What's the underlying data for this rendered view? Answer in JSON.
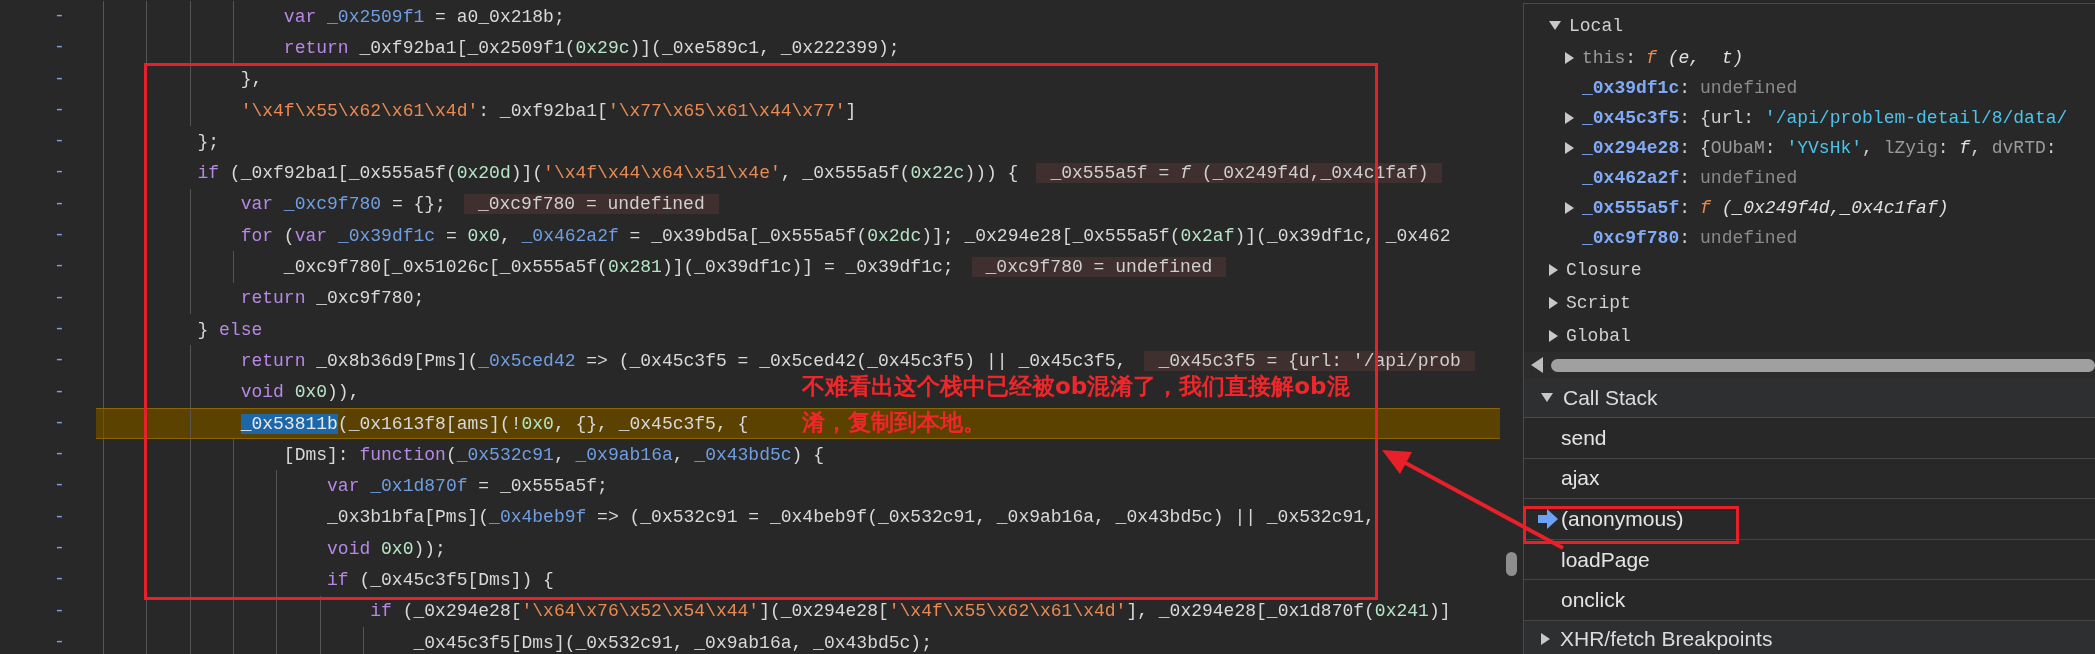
{
  "code_lines": [
    {
      "marker": "-",
      "paused": false,
      "tokens": [
        {
          "kind": "kw",
          "text": "                var "
        },
        {
          "kind": "def",
          "text": "_0x2509f1"
        },
        {
          "kind": "txt",
          "text": " = a0_0x218b;"
        }
      ]
    },
    {
      "marker": "-",
      "paused": false,
      "tokens": [
        {
          "kind": "kw",
          "text": "                return"
        },
        {
          "kind": "txt",
          "text": " _0xf92ba1[_0x2509f1("
        },
        {
          "kind": "num",
          "text": "0x29c"
        },
        {
          "kind": "txt",
          "text": ")](_0xe589c1, _0x222399);"
        }
      ]
    },
    {
      "marker": "-",
      "paused": false,
      "tokens": [
        {
          "kind": "txt",
          "text": "            },"
        }
      ]
    },
    {
      "marker": "-",
      "paused": false,
      "tokens": [
        {
          "kind": "str",
          "text": "            '\\x4f\\x55\\x62\\x61\\x4d'"
        },
        {
          "kind": "txt",
          "text": ": _0xf92ba1["
        },
        {
          "kind": "str",
          "text": "'\\x77\\x65\\x61\\x44\\x77'"
        },
        {
          "kind": "txt",
          "text": "]"
        }
      ]
    },
    {
      "marker": "-",
      "paused": false,
      "tokens": [
        {
          "kind": "txt",
          "text": "        };"
        }
      ]
    },
    {
      "marker": "-",
      "paused": false,
      "tokens": [
        {
          "kind": "kw",
          "text": "        if"
        },
        {
          "kind": "txt",
          "text": " (_0xf92ba1[_0x555a5f("
        },
        {
          "kind": "num",
          "text": "0x20d"
        },
        {
          "kind": "txt",
          "text": ")]("
        },
        {
          "kind": "str",
          "text": "'\\x4f\\x44\\x64\\x51\\x4e'"
        },
        {
          "kind": "txt",
          "text": ", _0x555a5f("
        },
        {
          "kind": "num",
          "text": "0x22c"
        },
        {
          "kind": "txt",
          "text": "))) {"
        }
      ],
      "inline_value": "_0x555a5f = *f* (_0x249f4d,_0x4c1faf)"
    },
    {
      "marker": "-",
      "paused": false,
      "tokens": [
        {
          "kind": "kw",
          "text": "            var "
        },
        {
          "kind": "def",
          "text": "_0xc9f780"
        },
        {
          "kind": "txt",
          "text": " = {};"
        }
      ],
      "inline_value": "_0xc9f780 = undefined"
    },
    {
      "marker": "-",
      "paused": false,
      "tokens": [
        {
          "kind": "kw",
          "text": "            for"
        },
        {
          "kind": "txt",
          "text": " ("
        },
        {
          "kind": "kw",
          "text": "var "
        },
        {
          "kind": "def",
          "text": "_0x39df1c"
        },
        {
          "kind": "txt",
          "text": " = "
        },
        {
          "kind": "num",
          "text": "0x0"
        },
        {
          "kind": "txt",
          "text": ", "
        },
        {
          "kind": "def",
          "text": "_0x462a2f"
        },
        {
          "kind": "txt",
          "text": " = _0x39bd5a[_0x555a5f("
        },
        {
          "kind": "num",
          "text": "0x2dc"
        },
        {
          "kind": "txt",
          "text": ")]; _0x294e28[_0x555a5f("
        },
        {
          "kind": "num",
          "text": "0x2af"
        },
        {
          "kind": "txt",
          "text": ")](_0x39df1c, _0x462"
        }
      ]
    },
    {
      "marker": "-",
      "paused": false,
      "tokens": [
        {
          "kind": "txt",
          "text": "                _0xc9f780[_0x51026c[_0x555a5f("
        },
        {
          "kind": "num",
          "text": "0x281"
        },
        {
          "kind": "txt",
          "text": ")](_0x39df1c)] = _0x39df1c;"
        }
      ],
      "inline_value": "_0xc9f780 = undefined"
    },
    {
      "marker": "-",
      "paused": false,
      "tokens": [
        {
          "kind": "kw",
          "text": "            return"
        },
        {
          "kind": "txt",
          "text": " _0xc9f780;"
        }
      ]
    },
    {
      "marker": "-",
      "paused": false,
      "tokens": [
        {
          "kind": "txt",
          "text": "        } "
        },
        {
          "kind": "kw",
          "text": "else"
        }
      ]
    },
    {
      "marker": "-",
      "paused": false,
      "tokens": [
        {
          "kind": "kw",
          "text": "            return"
        },
        {
          "kind": "txt",
          "text": " _0x8b36d9[Pms]("
        },
        {
          "kind": "def",
          "text": "_0x5ced42"
        },
        {
          "kind": "txt",
          "text": " => (_0x45c3f5 = _0x5ced42(_0x45c3f5) || _0x45c3f5,"
        }
      ],
      "inline_value": "_0x45c3f5 = {url: '/api/prob"
    },
    {
      "marker": "-",
      "paused": false,
      "tokens": [
        {
          "kind": "kw",
          "text": "            void "
        },
        {
          "kind": "num",
          "text": "0x0"
        },
        {
          "kind": "txt",
          "text": ")),"
        }
      ]
    },
    {
      "marker": "-",
      "paused": true,
      "tokens": [
        {
          "kind": "selection",
          "text": "            _0x53811b"
        },
        {
          "kind": "txt",
          "text": "(_0x1613f8[ams](!"
        },
        {
          "kind": "num",
          "text": "0x0"
        },
        {
          "kind": "txt",
          "text": ", {}, _0x45c3f5, {"
        }
      ]
    },
    {
      "marker": "-",
      "paused": false,
      "tokens": [
        {
          "kind": "txt",
          "text": "                [Dms]: "
        },
        {
          "kind": "kw",
          "text": "function"
        },
        {
          "kind": "txt",
          "text": "("
        },
        {
          "kind": "def",
          "text": "_0x532c91"
        },
        {
          "kind": "txt",
          "text": ", "
        },
        {
          "kind": "def",
          "text": "_0x9ab16a"
        },
        {
          "kind": "txt",
          "text": ", "
        },
        {
          "kind": "def",
          "text": "_0x43bd5c"
        },
        {
          "kind": "txt",
          "text": ") {"
        }
      ]
    },
    {
      "marker": "-",
      "paused": false,
      "tokens": [
        {
          "kind": "kw",
          "text": "                    var "
        },
        {
          "kind": "def",
          "text": "_0x1d870f"
        },
        {
          "kind": "txt",
          "text": " = _0x555a5f;"
        }
      ]
    },
    {
      "marker": "-",
      "paused": false,
      "tokens": [
        {
          "kind": "txt",
          "text": "                    _0x3b1bfa[Pms]("
        },
        {
          "kind": "def",
          "text": "_0x4beb9f"
        },
        {
          "kind": "txt",
          "text": " => (_0x532c91 = _0x4beb9f(_0x532c91, _0x9ab16a, _0x43bd5c) || _0x532c91,"
        }
      ]
    },
    {
      "marker": "-",
      "paused": false,
      "tokens": [
        {
          "kind": "kw",
          "text": "                    void "
        },
        {
          "kind": "num",
          "text": "0x0"
        },
        {
          "kind": "txt",
          "text": "));"
        }
      ]
    },
    {
      "marker": "-",
      "paused": false,
      "tokens": [
        {
          "kind": "kw",
          "text": "                    if"
        },
        {
          "kind": "txt",
          "text": " (_0x45c3f5[Dms]) {"
        }
      ]
    },
    {
      "marker": "-",
      "paused": false,
      "tokens": [
        {
          "kind": "kw",
          "text": "                        if"
        },
        {
          "kind": "txt",
          "text": " (_0x294e28["
        },
        {
          "kind": "str",
          "text": "'\\x64\\x76\\x52\\x54\\x44'"
        },
        {
          "kind": "txt",
          "text": "](_0x294e28["
        },
        {
          "kind": "str",
          "text": "'\\x4f\\x55\\x62\\x61\\x4d'"
        },
        {
          "kind": "txt",
          "text": "], _0x294e28[_0x1d870f("
        },
        {
          "kind": "num",
          "text": "0x241"
        },
        {
          "kind": "txt",
          "text": ")]"
        }
      ]
    },
    {
      "marker": "-",
      "paused": false,
      "tokens": [
        {
          "kind": "txt",
          "text": "                            _0x45c3f5[Dms](_0x532c91, _0x9ab16a, _0x43bd5c);"
        }
      ]
    }
  ],
  "scope": {
    "sections": [
      {
        "title": "Local",
        "expanded": true,
        "items": [
          {
            "name": "this",
            "colon": ":",
            "dimmed": true,
            "expandable": true,
            "value": [
              {
                "kind": "fn",
                "text": "f"
              },
              {
                "kind": "italic",
                "text": " (e,  t)"
              }
            ]
          },
          {
            "name": "_0x39df1c",
            "colon": ":",
            "dimmed": false,
            "expandable": false,
            "value": [
              {
                "kind": "undef",
                "text": "undefined"
              }
            ]
          },
          {
            "name": "_0x45c3f5",
            "colon": ":",
            "dimmed": false,
            "expandable": true,
            "value": [
              {
                "kind": "plain",
                "text": "{url: "
              },
              {
                "kind": "str",
                "text": "'/api/problem-detail/8/data/"
              }
            ]
          },
          {
            "name": "_0x294e28",
            "colon": ":",
            "dimmed": false,
            "expandable": true,
            "value": [
              {
                "kind": "plain",
                "text": "{"
              },
              {
                "kind": "key",
                "text": "OUbaM"
              },
              {
                "kind": "plain",
                "text": ": "
              },
              {
                "kind": "str",
                "text": "'YVsHk'"
              },
              {
                "kind": "plain",
                "text": ", "
              },
              {
                "kind": "key",
                "text": "lZyig"
              },
              {
                "kind": "plain",
                "text": ": "
              },
              {
                "kind": "italic",
                "text": "f"
              },
              {
                "kind": "plain",
                "text": ", "
              },
              {
                "kind": "key",
                "text": "dvRTD"
              },
              {
                "kind": "plain",
                "text": ":"
              }
            ]
          },
          {
            "name": "_0x462a2f",
            "colon": ":",
            "dimmed": false,
            "expandable": false,
            "value": [
              {
                "kind": "undef",
                "text": "undefined"
              }
            ]
          },
          {
            "name": "_0x555a5f",
            "colon": ":",
            "dimmed": false,
            "expandable": true,
            "value": [
              {
                "kind": "fn",
                "text": "f"
              },
              {
                "kind": "italic",
                "text": " (_0x249f4d,_0x4c1faf)"
              }
            ]
          },
          {
            "name": "_0xc9f780",
            "colon": ":",
            "dimmed": false,
            "expandable": false,
            "value": [
              {
                "kind": "undef",
                "text": "undefined"
              }
            ]
          }
        ]
      },
      {
        "title": "Closure",
        "expanded": false
      },
      {
        "title": "Script",
        "expanded": false
      },
      {
        "title": "Global",
        "expanded": false
      }
    ]
  },
  "call_stack": {
    "title": "Call Stack",
    "expanded": true,
    "frames": [
      {
        "name": "send",
        "selected": false
      },
      {
        "name": "ajax",
        "selected": false
      },
      {
        "name": "(anonymous)",
        "selected": true
      },
      {
        "name": "loadPage",
        "selected": false
      },
      {
        "name": "onclick",
        "selected": false
      }
    ]
  },
  "breakpoints": {
    "title": "XHR/fetch Breakpoints",
    "expanded": false
  },
  "annotation": {
    "text": "不难看出这个栈中已经被ob混淆了，我们直接解ob混淆，复制到本地。"
  }
}
